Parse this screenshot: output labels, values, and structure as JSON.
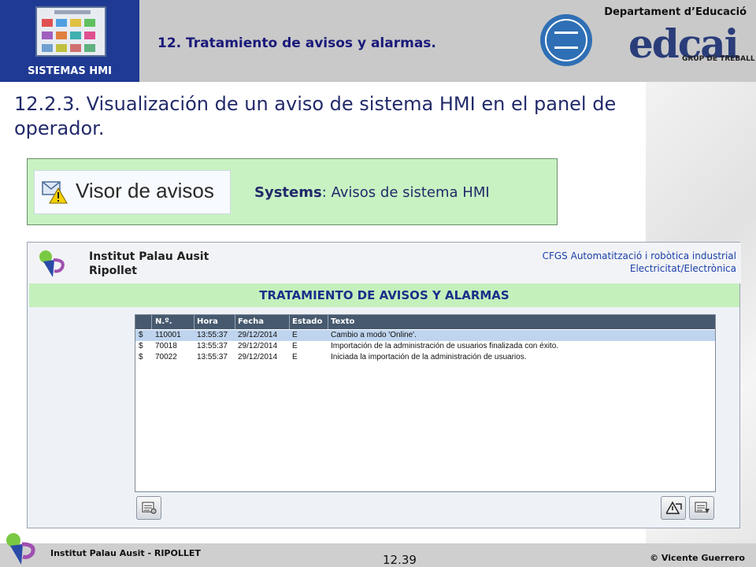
{
  "header": {
    "logo_label": "SISTEMAS HMI",
    "section_title": "12. Tratamiento de avisos y alarmas.",
    "dept": "Departament d’Educació",
    "brand": "edcai",
    "brand_sub": "GRUP DE TREBALL"
  },
  "slide": {
    "title": "12.2.3. Visualización de un aviso de sistema HMI en el panel de operador."
  },
  "visor": {
    "image_label": "Visor de avisos",
    "desc_bold": "Systems",
    "desc_rest": ": Avisos de sistema HMI"
  },
  "hmi": {
    "institute_line1": "Institut Palau Ausit",
    "institute_line2": "Ripollet",
    "cfgs_line1": "CFGS Automatització i robòtica industrial",
    "cfgs_line2": "Electricitat/Electrònica",
    "band_title": "TRATAMIENTO DE AVISOS Y ALARMAS",
    "columns": [
      "N.º.",
      "Hora",
      "Fecha",
      "Estado",
      "Texto"
    ],
    "rows": [
      {
        "icon": "$",
        "num": "110001",
        "hora": "13:55:37",
        "fecha": "29/12/2014",
        "estado": "E",
        "texto": "Cambio a modo 'Online'."
      },
      {
        "icon": "$",
        "num": "70018",
        "hora": "13:55:37",
        "fecha": "29/12/2014",
        "estado": "E",
        "texto": "Importación de la administración de usuarios finalizada con éxito."
      },
      {
        "icon": "$",
        "num": "70022",
        "hora": "13:55:37",
        "fecha": "29/12/2014",
        "estado": "E",
        "texto": "Iniciada la importación de la administración de usuarios."
      }
    ],
    "selected_row": 0,
    "buttons": {
      "left_icon": "list-settings-icon",
      "acknowledge_icon": "acknowledge-icon",
      "loop_icon": "list-edit-icon"
    }
  },
  "footer": {
    "institute": "Institut Palau Ausit - RIPOLLET",
    "page": "12.39",
    "copyright": "© Vicente Guerrero"
  },
  "colors": {
    "header_bg": "#c9c9c9",
    "logo_bg": "#1f3a93",
    "title_blue": "#222a6a",
    "green_band": "#c4f0bc",
    "table_header": "#46596e",
    "selected_row": "#bfd4ee"
  }
}
